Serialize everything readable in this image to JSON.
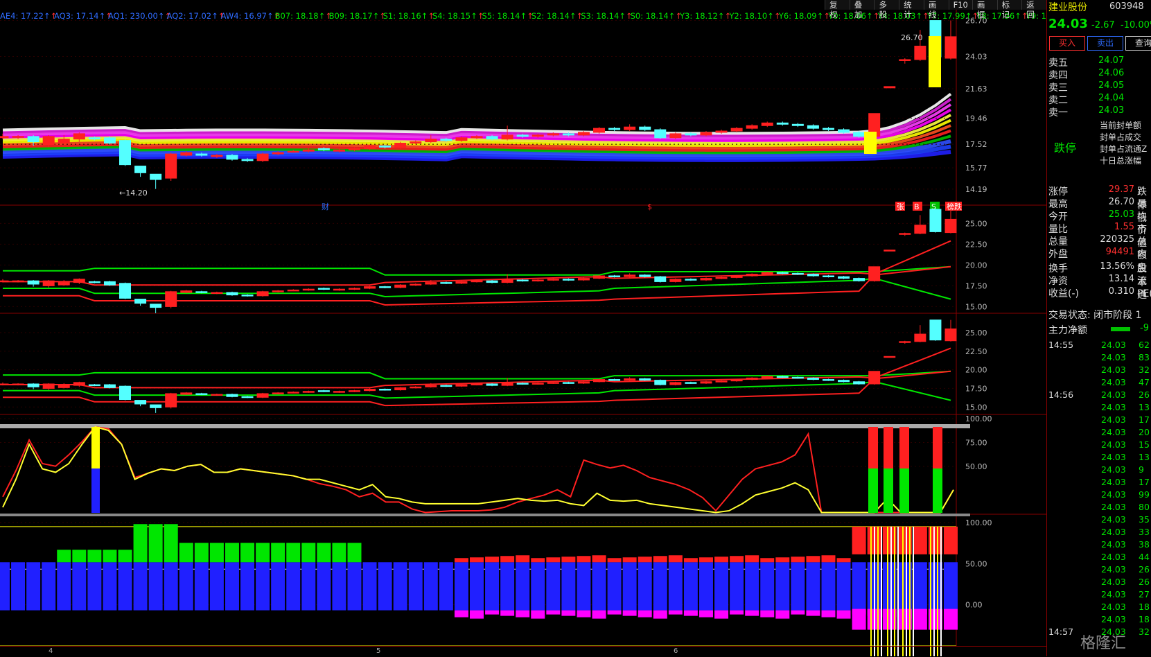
{
  "toolbar": [
    "复权",
    "叠加",
    "多股",
    "统计",
    "画线",
    "F10",
    "画框",
    "标记",
    "返回"
  ],
  "indicators": [
    {
      "text": "AE4: 17.22",
      "c": "#2f6cff"
    },
    {
      "text": "AQ3: 17.14",
      "c": "#2f6cff"
    },
    {
      "text": "AQ1: 230.00",
      "c": "#2f6cff"
    },
    {
      "text": "AQ2: 17.02",
      "c": "#2f6cff"
    },
    {
      "text": "AW4: 16.97",
      "c": "#2f6cff"
    },
    {
      "text": "B07: 18.18",
      "c": "#00e600"
    },
    {
      "text": "B09: 18.17",
      "c": "#00e600"
    },
    {
      "text": "S1: 18.16",
      "c": "#00e600"
    },
    {
      "text": "S4: 18.15",
      "c": "#00e600"
    },
    {
      "text": "S5: 18.14",
      "c": "#00e600"
    },
    {
      "text": "S2: 18.14",
      "c": "#00e600"
    },
    {
      "text": "S3: 18.14",
      "c": "#00e600"
    },
    {
      "text": "S0: 18.14",
      "c": "#00e600"
    },
    {
      "text": "Y3: 18.12",
      "c": "#00e600"
    },
    {
      "text": "Y2: 18.10",
      "c": "#00e600"
    },
    {
      "text": "Y6: 18.09",
      "c": "#00e600"
    },
    {
      "text": "Y0: 18.06",
      "c": "#00e600"
    },
    {
      "text": "Y4: 18.03",
      "c": "#00e600"
    },
    {
      "text": "Y7: 17.99",
      "c": "#00e600"
    },
    {
      "text": "Y8: 17.96",
      "c": "#00e600"
    },
    {
      "text": "Y9: 17.9",
      "c": "#00e600"
    }
  ],
  "chart_data": [
    {
      "type": "candlestick",
      "panel": "main",
      "ylim": [
        13.0,
        27.5
      ],
      "y_ticks": [
        26.7,
        24.03,
        21.63,
        19.46,
        17.52,
        15.77,
        14.19
      ],
      "annotations": {
        "high_label": "26.70",
        "low_label": "←14.20",
        "events": [
          "财",
          "$",
          "张",
          "B",
          "S",
          "榜跌"
        ]
      },
      "candles": [
        [
          18.0,
          18.1,
          18.3,
          17.9
        ],
        [
          18.1,
          18.1,
          18.2,
          17.9
        ],
        [
          18.1,
          17.7,
          18.2,
          17.4
        ],
        [
          17.5,
          18.1,
          18.2,
          17.3
        ],
        [
          17.6,
          17.9,
          18.2,
          17.5
        ],
        [
          17.9,
          18.3,
          18.4,
          17.7
        ],
        [
          18.0,
          17.9,
          18.1,
          17.8
        ],
        [
          18.0,
          17.6,
          18.1,
          17.5
        ],
        [
          17.8,
          16.0,
          17.9,
          15.9
        ],
        [
          15.9,
          15.4,
          15.9,
          15.1
        ],
        [
          15.3,
          14.9,
          15.3,
          14.2
        ],
        [
          15.0,
          16.8,
          16.9,
          14.8
        ],
        [
          16.7,
          16.9,
          17.0,
          16.6
        ],
        [
          16.8,
          16.7,
          16.9,
          16.6
        ],
        [
          16.6,
          16.7,
          16.8,
          16.5
        ],
        [
          16.7,
          16.4,
          16.8,
          16.3
        ],
        [
          16.4,
          16.3,
          16.5,
          16.2
        ],
        [
          16.3,
          16.8,
          16.9,
          16.2
        ],
        [
          16.8,
          16.9,
          17.0,
          16.7
        ],
        [
          17.0,
          17.0,
          17.1,
          16.9
        ],
        [
          17.0,
          17.1,
          17.2,
          16.9
        ],
        [
          17.2,
          17.1,
          17.3,
          17.0
        ],
        [
          17.0,
          17.1,
          17.2,
          16.9
        ],
        [
          17.1,
          17.2,
          17.3,
          17.0
        ],
        [
          17.2,
          17.4,
          17.5,
          17.1
        ],
        [
          17.4,
          17.3,
          17.5,
          17.2
        ],
        [
          17.3,
          17.6,
          17.7,
          17.2
        ],
        [
          17.6,
          17.7,
          17.8,
          17.5
        ],
        [
          17.7,
          17.9,
          18.2,
          17.6
        ],
        [
          17.9,
          17.8,
          18.0,
          17.7
        ],
        [
          17.8,
          18.0,
          18.1,
          17.7
        ],
        [
          18.0,
          18.1,
          18.2,
          17.9
        ],
        [
          18.1,
          17.9,
          18.2,
          17.8
        ],
        [
          17.9,
          18.2,
          18.9,
          17.8
        ],
        [
          18.2,
          18.1,
          18.3,
          18.0
        ],
        [
          18.1,
          18.2,
          18.3,
          18.0
        ],
        [
          18.2,
          18.3,
          18.4,
          18.1
        ],
        [
          18.3,
          18.2,
          18.4,
          18.1
        ],
        [
          18.2,
          18.4,
          18.5,
          18.1
        ],
        [
          18.4,
          18.7,
          18.8,
          18.3
        ],
        [
          18.7,
          18.6,
          18.8,
          18.5
        ],
        [
          18.6,
          18.8,
          19.0,
          18.5
        ],
        [
          18.8,
          18.6,
          18.9,
          18.5
        ],
        [
          18.6,
          18.0,
          18.7,
          17.9
        ],
        [
          18.0,
          18.3,
          18.4,
          17.9
        ],
        [
          18.3,
          18.2,
          18.4,
          18.1
        ],
        [
          18.2,
          18.4,
          18.5,
          18.1
        ],
        [
          18.4,
          18.5,
          18.6,
          18.3
        ],
        [
          18.5,
          18.7,
          18.8,
          18.4
        ],
        [
          18.7,
          18.9,
          19.0,
          18.6
        ],
        [
          18.9,
          19.1,
          19.2,
          18.8
        ],
        [
          19.1,
          19.0,
          19.2,
          18.9
        ],
        [
          19.0,
          18.9,
          19.1,
          18.8
        ],
        [
          18.9,
          18.7,
          19.0,
          18.6
        ],
        [
          18.7,
          18.6,
          18.8,
          18.5
        ],
        [
          18.6,
          18.4,
          18.7,
          18.3
        ],
        [
          18.4,
          18.1,
          18.5,
          18.0
        ],
        [
          18.1,
          19.8,
          19.8,
          18.0
        ],
        [
          21.7,
          21.8,
          21.8,
          21.7
        ],
        [
          23.8,
          23.8,
          23.9,
          23.5
        ],
        [
          23.8,
          24.8,
          26.0,
          23.7
        ],
        [
          26.7,
          24.0,
          26.7,
          23.9
        ],
        [
          23.9,
          25.5,
          26.7,
          23.8
        ]
      ]
    },
    {
      "type": "candlestick-with-bands",
      "panel": "band1",
      "ylim": [
        14.2,
        27.2
      ],
      "y_ticks": [
        25.0,
        22.5,
        20.0,
        17.5,
        15.0
      ]
    },
    {
      "type": "candlestick-with-bands",
      "panel": "band2",
      "ylim": [
        14.0,
        27.6
      ],
      "y_ticks": [
        25.0,
        22.5,
        20.0,
        17.5,
        15.0
      ]
    },
    {
      "type": "line",
      "panel": "oscillator",
      "ylim": [
        0,
        100
      ],
      "y_ticks": [
        100.0,
        75.0,
        50.0
      ],
      "series": [
        {
          "color": "#ff2020",
          "values": [
            20,
            50,
            85,
            58,
            55,
            68,
            83,
            100,
            98,
            80,
            42,
            47,
            52,
            50,
            55,
            57,
            48,
            48,
            52,
            50,
            48,
            46,
            44,
            40,
            35,
            32,
            28,
            20,
            24,
            14,
            14,
            6,
            2,
            3,
            4,
            4,
            4,
            5,
            8,
            14,
            18,
            22,
            28,
            20,
            62,
            57,
            53,
            56,
            50,
            42,
            38,
            34,
            28,
            19,
            4,
            22,
            40,
            52,
            56,
            60,
            68,
            92,
            2,
            2,
            2,
            2,
            2,
            2,
            2,
            2,
            2,
            2,
            28
          ]
        },
        {
          "color": "#ffff30",
          "values": [
            8,
            40,
            80,
            52,
            48,
            58,
            80,
            100,
            96,
            80,
            40,
            47,
            52,
            50,
            55,
            57,
            48,
            48,
            52,
            50,
            48,
            46,
            44,
            40,
            40,
            36,
            32,
            28,
            34,
            20,
            18,
            14,
            12,
            12,
            12,
            12,
            12,
            14,
            16,
            18,
            16,
            15,
            16,
            12,
            10,
            24,
            16,
            15,
            16,
            12,
            10,
            8,
            6,
            4,
            2,
            4,
            12,
            22,
            26,
            30,
            36,
            28,
            2,
            2,
            2,
            2,
            2,
            18,
            2,
            2,
            2,
            2,
            28
          ]
        }
      ]
    },
    {
      "type": "bar",
      "panel": "volume-strength",
      "ylim": [
        -50,
        110
      ],
      "y_ticks": [
        100.0,
        50.0,
        0.0
      ]
    }
  ],
  "side": {
    "name": "建业股份",
    "code": "603948",
    "price": "24.03",
    "change": "-2.67",
    "pct": "-10.00%",
    "buy": "买入",
    "sell": "卖出",
    "query": "查询",
    "asks": [
      {
        "l": "卖五",
        "v": "24.07"
      },
      {
        "l": "卖四",
        "v": "24.06"
      },
      {
        "l": "卖三",
        "v": "24.05"
      },
      {
        "l": "卖二",
        "v": "24.04"
      },
      {
        "l": "卖一",
        "v": "24.03"
      }
    ],
    "limit_label": "跌停",
    "limit_info": [
      "当前封单额",
      "封单占成交",
      "封单占流通Z",
      "十日总涨幅"
    ],
    "stats": [
      {
        "l": "涨停",
        "v": "29.37",
        "c": "red",
        "l2": "跌停"
      },
      {
        "l": "最高",
        "v": "26.70",
        "c": "wht",
        "l2": "最低"
      },
      {
        "l": "今开",
        "v": "25.03",
        "c": "grn",
        "l2": "均价"
      },
      {
        "l": "量比",
        "v": "1.55",
        "c": "red",
        "l2": "市值"
      },
      {
        "l": "总量",
        "v": "220325",
        "c": "wht",
        "l2": "总额"
      },
      {
        "l": "外盘",
        "v": "94491",
        "c": "red",
        "l2": "内盘"
      },
      {
        "l": "换手",
        "v": "13.56%",
        "c": "wht",
        "l2": "股本"
      },
      {
        "l": "净资",
        "v": "13.14",
        "c": "wht",
        "l2": "流通"
      },
      {
        "l": "收益(-)",
        "v": "0.310",
        "c": "wht",
        "l2": "PE(动"
      }
    ],
    "status": "交易状态: 闭市阶段 1",
    "net_label": "主力净额",
    "net_value": "-9",
    "ticks": [
      {
        "t": "14:55",
        "p": "24.03",
        "v": "62"
      },
      {
        "t": "",
        "p": "24.03",
        "v": "83"
      },
      {
        "t": "",
        "p": "24.03",
        "v": "32"
      },
      {
        "t": "",
        "p": "24.03",
        "v": "47"
      },
      {
        "t": "14:56",
        "p": "24.03",
        "v": "26"
      },
      {
        "t": "",
        "p": "24.03",
        "v": "13"
      },
      {
        "t": "",
        "p": "24.03",
        "v": "17"
      },
      {
        "t": "",
        "p": "24.03",
        "v": "20"
      },
      {
        "t": "",
        "p": "24.03",
        "v": "15"
      },
      {
        "t": "",
        "p": "24.03",
        "v": "13"
      },
      {
        "t": "",
        "p": "24.03",
        "v": "9"
      },
      {
        "t": "",
        "p": "24.03",
        "v": "17"
      },
      {
        "t": "",
        "p": "24.03",
        "v": "99"
      },
      {
        "t": "",
        "p": "24.03",
        "v": "80"
      },
      {
        "t": "",
        "p": "24.03",
        "v": "35"
      },
      {
        "t": "",
        "p": "24.03",
        "v": "33"
      },
      {
        "t": "",
        "p": "24.03",
        "v": "38"
      },
      {
        "t": "",
        "p": "24.03",
        "v": "44"
      },
      {
        "t": "",
        "p": "24.03",
        "v": "26"
      },
      {
        "t": "",
        "p": "24.03",
        "v": "26"
      },
      {
        "t": "",
        "p": "24.03",
        "v": "27"
      },
      {
        "t": "",
        "p": "24.03",
        "v": "18"
      },
      {
        "t": "",
        "p": "24.03",
        "v": "18"
      },
      {
        "t": "14:57",
        "p": "24.03",
        "v": "32"
      }
    ],
    "watermark": "格隆汇",
    "tf": "日线"
  },
  "axis_marks": [
    "4",
    "5",
    "6"
  ]
}
